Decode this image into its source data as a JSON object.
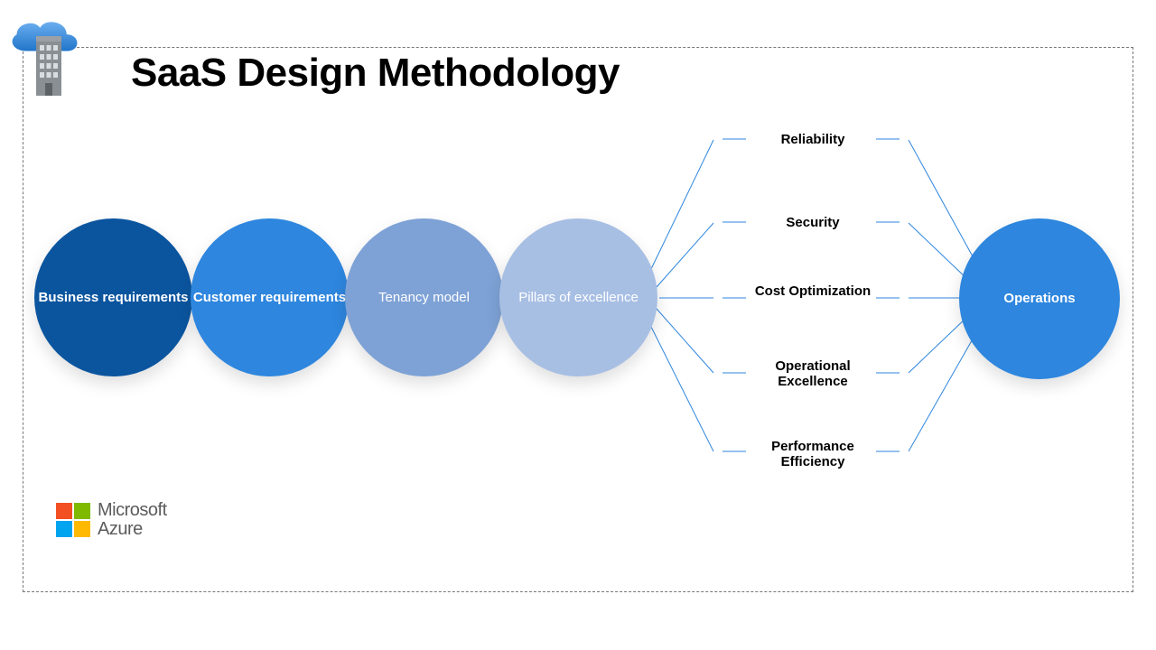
{
  "title": "SaaS Design Methodology",
  "circles": {
    "c1": "Business requirements",
    "c2": "Customer requirements",
    "c3": "Tenancy model",
    "c4": "Pillars of excellence",
    "c5": "Operations"
  },
  "pillars": {
    "p1": "Reliability",
    "p2": "Security",
    "p3": "Cost Optimization",
    "p4": "Operational Excellence",
    "p5": "Performance Efficiency"
  },
  "logo": {
    "line1": "Microsoft",
    "line2": "Azure"
  },
  "colors": {
    "line": "#2e86de",
    "circle_dark": "#0b559f",
    "circle_blue": "#2e86de",
    "circle_mid": "#7ea2d6",
    "circle_light": "#a8bfe4"
  }
}
